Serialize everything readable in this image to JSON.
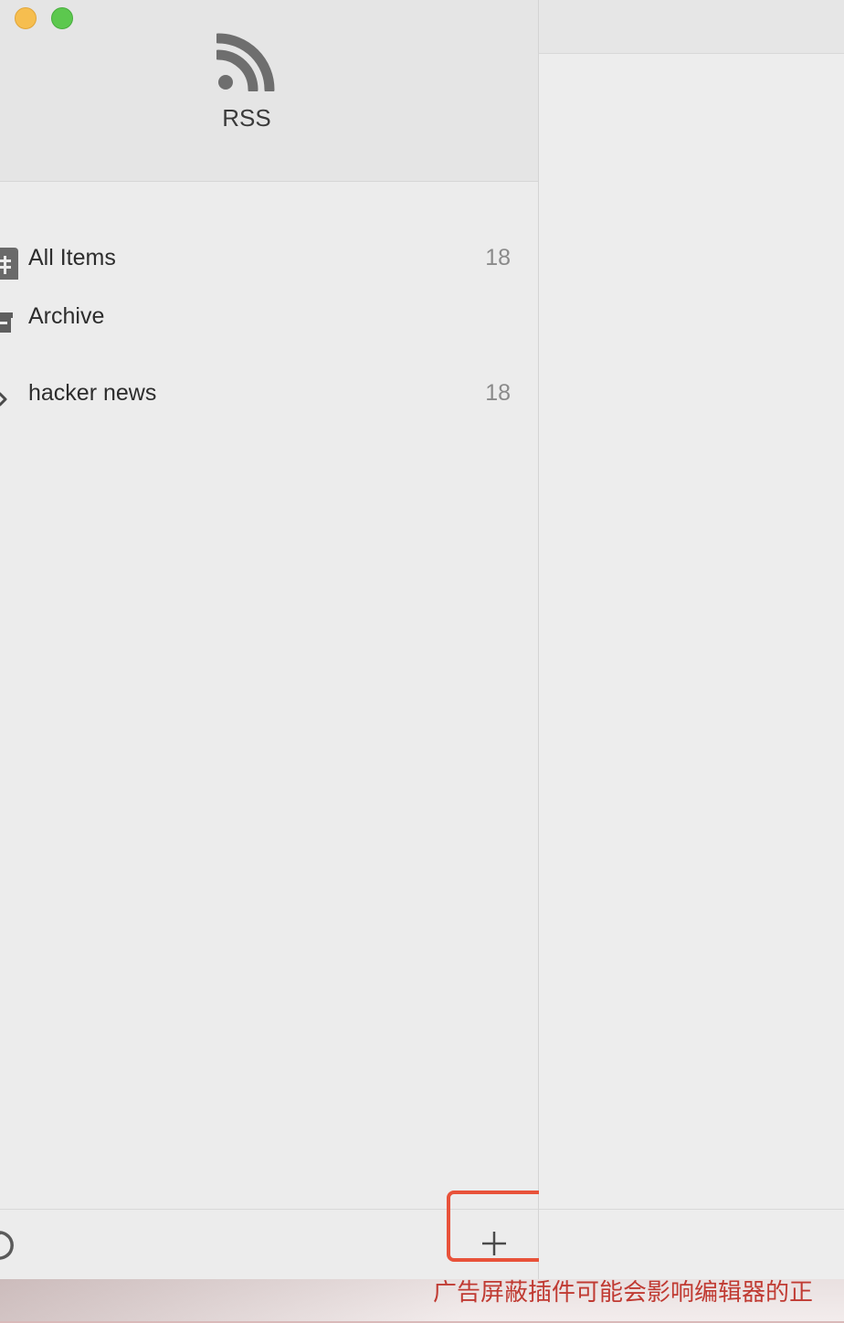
{
  "window": {
    "traffic_lights": [
      "minimize",
      "zoom"
    ],
    "colors": {
      "minimize": "#f6be4f",
      "zoom": "#5cc84e"
    }
  },
  "sidebar": {
    "app_icon": "rss-icon",
    "app_title": "RSS",
    "items": [
      {
        "icon": "all-items-icon",
        "label": "All Items",
        "count": "18"
      },
      {
        "icon": "archive-icon",
        "label": "Archive",
        "count": ""
      },
      {
        "icon": "chevron-right-icon",
        "label": "hacker news",
        "count": "18"
      }
    ],
    "footer": {
      "refresh_icon": "refresh-icon",
      "add_icon": "plus-icon",
      "highlight_color": "#e8523a"
    }
  },
  "bottom_notice": {
    "text": "广告屏蔽插件可能会影响编辑器的正"
  }
}
